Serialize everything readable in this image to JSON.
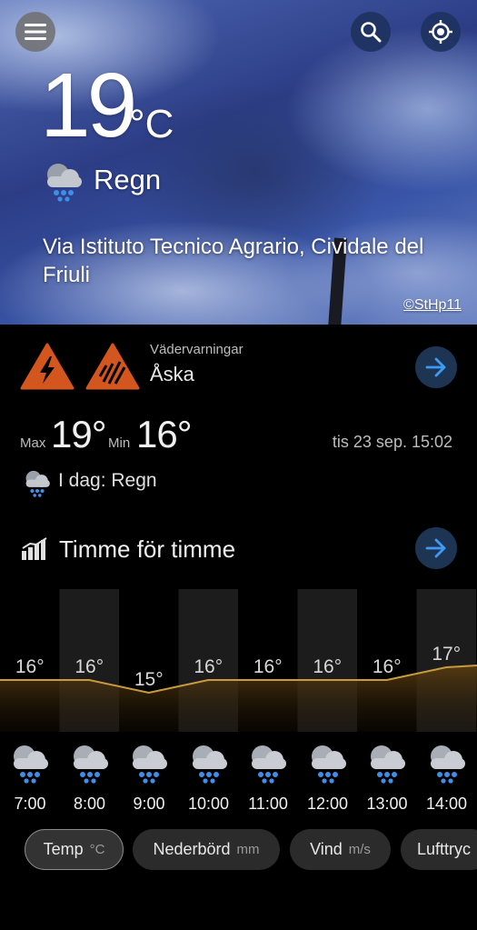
{
  "current": {
    "temperature": "19",
    "unit": "°C",
    "condition": "Regn",
    "location": "Via Istituto Tecnico Agrario, Cividale del Friuli",
    "photo_credit": "©StHp11"
  },
  "warnings": {
    "caption": "Vädervarningar",
    "value": "Åska",
    "icons": [
      "lightning-warning-icon",
      "storm-rain-warning-icon"
    ],
    "color": "#d4561f"
  },
  "today": {
    "max_label": "Max",
    "max_value": "19°",
    "min_label": "Min",
    "min_value": "16°",
    "datetime": "tis 23 sep. 15:02",
    "summary": "I dag: Regn"
  },
  "hourly": {
    "title": "Timme för timme",
    "hours": [
      {
        "time": "7:00",
        "temp": "16°"
      },
      {
        "time": "8:00",
        "temp": "16°"
      },
      {
        "time": "9:00",
        "temp": "15°"
      },
      {
        "time": "10:00",
        "temp": "16°"
      },
      {
        "time": "11:00",
        "temp": "16°"
      },
      {
        "time": "12:00",
        "temp": "16°"
      },
      {
        "time": "13:00",
        "temp": "16°"
      },
      {
        "time": "14:00",
        "temp": "17°"
      }
    ]
  },
  "chart_data": {
    "type": "line",
    "categories": [
      "7:00",
      "8:00",
      "9:00",
      "10:00",
      "11:00",
      "12:00",
      "13:00",
      "14:00"
    ],
    "values": [
      16,
      16,
      15,
      16,
      16,
      16,
      16,
      17
    ],
    "ylabel": "°C"
  },
  "chips": [
    {
      "label": "Temp",
      "unit": "°C",
      "active": true
    },
    {
      "label": "Nederbörd",
      "unit": "mm",
      "active": false
    },
    {
      "label": "Vind",
      "unit": "m/s",
      "active": false
    },
    {
      "label": "Lufttryc",
      "unit": "",
      "active": false
    }
  ],
  "colors": {
    "accent": "#2d8cf0",
    "chart_line": "#c99a3e",
    "rain_drop": "#3f8ee8"
  }
}
